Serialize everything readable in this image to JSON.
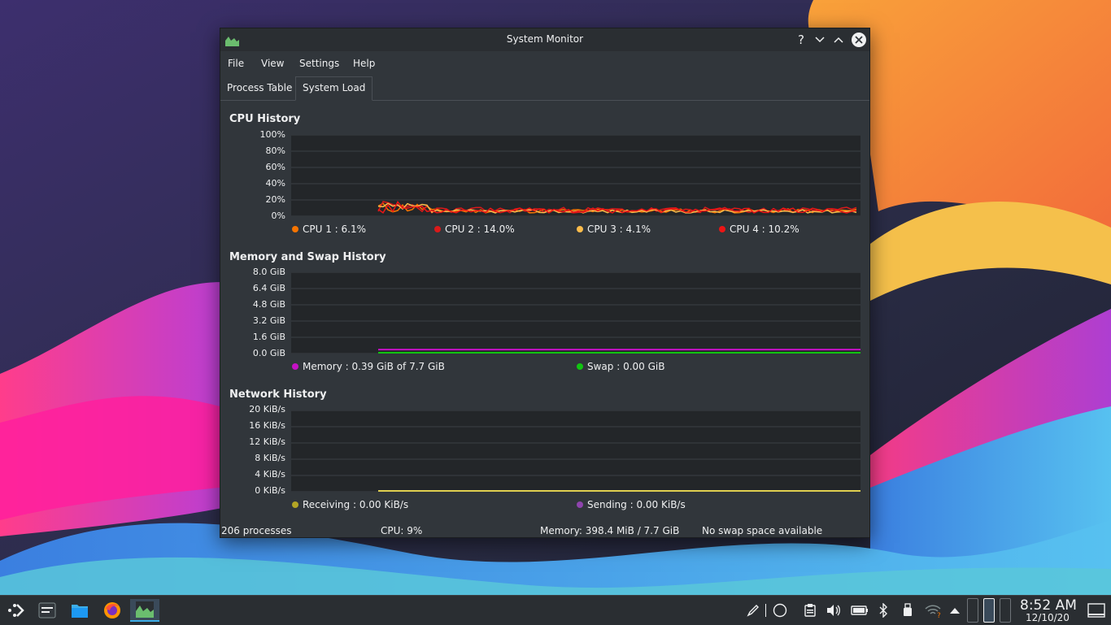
{
  "window": {
    "title": "System Monitor"
  },
  "menu": [
    "File",
    "View",
    "Settings",
    "Help"
  ],
  "tabs": [
    "Process Table",
    "System Load"
  ],
  "cpu": {
    "title": "CPU History",
    "yticks": [
      "100%",
      "80%",
      "60%",
      "40%",
      "20%",
      "0%"
    ],
    "legend": [
      "CPU 1 : 6.1%",
      "CPU 2 : 14.0%",
      "CPU 3 : 4.1%",
      "CPU 4 : 10.2%"
    ]
  },
  "memory": {
    "title": "Memory and Swap History",
    "yticks": [
      "8.0 GiB",
      "6.4 GiB",
      "4.8 GiB",
      "3.2 GiB",
      "1.6 GiB",
      "0.0 GiB"
    ],
    "legend": [
      "Memory : 0.39 GiB of 7.7 GiB",
      "Swap : 0.00 GiB"
    ]
  },
  "network": {
    "title": "Network History",
    "yticks": [
      "20 KiB/s",
      "16 KiB/s",
      "12 KiB/s",
      "8 KiB/s",
      "4 KiB/s",
      "0 KiB/s"
    ],
    "legend": [
      "Receiving : 0.00 KiB/s",
      "Sending : 0.00 KiB/s"
    ]
  },
  "status": {
    "processes": "206 processes",
    "cpu": "CPU: 9%",
    "memory": "Memory: 398.4 MiB / 7.7 GiB",
    "swap": "No swap space available"
  },
  "colors": {
    "cpu1": "#f67400",
    "cpu2": "#da1a1a",
    "cpu3": "#fdbc4b",
    "cpu4": "#ed1515",
    "memory": "#c511c5",
    "swap": "#11c511",
    "receiving": "#b3a525",
    "sending": "#8e44ad",
    "accent": "#3daee9"
  },
  "series": {
    "cpu_percent_latest": [
      6.1,
      14.0,
      4.1,
      10.2
    ],
    "memory_gib": 0.39,
    "swap_gib": 0.0,
    "receiving_kibs": 0.0,
    "sending_kibs": 0.0
  },
  "taskbar": {
    "time": "8:52 AM",
    "date": "12/10/20",
    "launchers": [
      "application-launcher-icon",
      "task-manager-icon",
      "dolphin-file-manager-icon",
      "firefox-icon",
      "system-monitor-icon"
    ],
    "tray": [
      "pen-icon",
      "circle-icon",
      "clipboard-icon",
      "volume-icon",
      "battery-icon",
      "bluetooth-icon",
      "usb-device-icon",
      "wifi-icon",
      "expand-tray-icon"
    ]
  }
}
